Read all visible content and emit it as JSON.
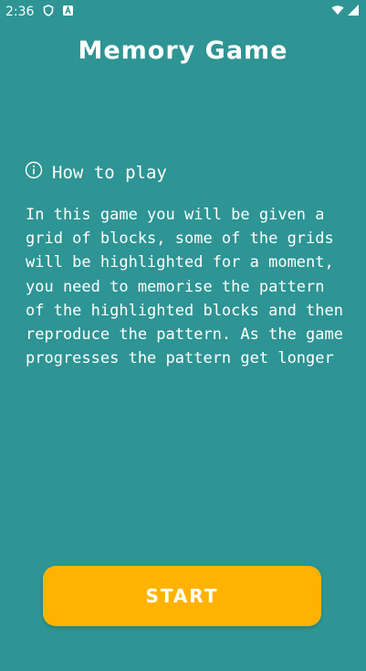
{
  "status_bar": {
    "time": "2:36",
    "icons": [
      "shield-icon",
      "a-badge-icon",
      "wifi-icon",
      "signal-icon"
    ]
  },
  "header": {
    "title": "Memory Game"
  },
  "section": {
    "icon": "info-icon",
    "heading": "How to play",
    "body": "In this game you will be given a grid of blocks, some of the grids will be highlighted for a moment, you need to memorise the pattern of the highlighted blocks and then reproduce the pattern. As the game progresses the pattern get longer"
  },
  "actions": {
    "start_label": "START"
  },
  "colors": {
    "background": "#2e9494",
    "accent": "#ffb300",
    "text": "#ffffff"
  }
}
